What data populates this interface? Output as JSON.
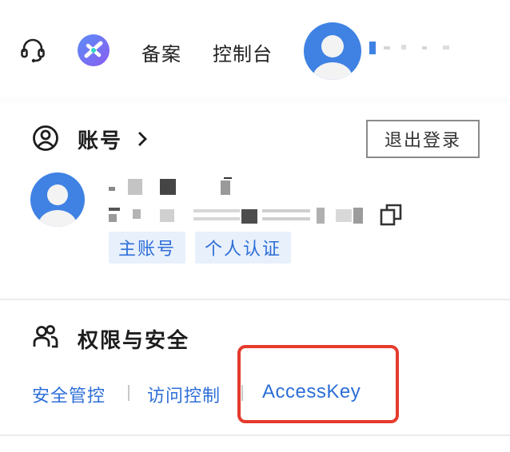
{
  "topbar": {
    "icons": [
      "headset-icon",
      "app-logo-icon"
    ],
    "filing_link": "备案",
    "console_link": "控制台"
  },
  "account": {
    "title": "账号",
    "logout_label": "退出登录",
    "tags": [
      "主账号",
      "个人认证"
    ]
  },
  "permissions": {
    "title": "权限与安全",
    "links": [
      "安全管控",
      "访问控制",
      "AccessKey"
    ]
  },
  "colors": {
    "link_blue": "#2d6ed8",
    "tag_bg": "#e8f0fc",
    "highlight_red": "#e53a2c",
    "avatar_blue": "#3f82e3"
  }
}
